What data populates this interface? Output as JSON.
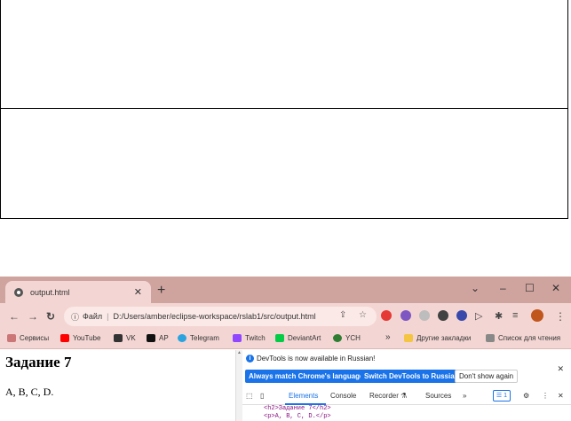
{
  "browser": {
    "tab_title": "output.html",
    "tab_close": "✕",
    "new_tab": "+",
    "window_controls": [
      "⌄",
      "–",
      "☐",
      "✕"
    ],
    "address_prefix": "Файл",
    "address_path": "D:/Users/amber/eclipse-workspace/rslab1/src/output.html",
    "bookmarks": [
      {
        "label": "Сервисы",
        "icon": "apps-icon",
        "color": "#6a6a6a"
      },
      {
        "label": "YouTube",
        "icon": "youtube-icon",
        "color": "#ff0000"
      },
      {
        "label": "VK",
        "icon": "vk-icon",
        "color": "#333333"
      },
      {
        "label": "AP",
        "icon": "ap-icon",
        "color": "#111111"
      },
      {
        "label": "Telegram",
        "icon": "telegram-icon",
        "color": "#2aa3df"
      },
      {
        "label": "Twitch",
        "icon": "twitch-icon",
        "color": "#9146ff"
      },
      {
        "label": "DeviantArt",
        "icon": "deviantart-icon",
        "color": "#05cc47"
      },
      {
        "label": "YCH",
        "icon": "ych-icon",
        "color": "#2e7d32"
      }
    ],
    "bookmarks_more": "»",
    "other_bookmarks": "Другие закладки",
    "reading_list": "Список для чтения"
  },
  "page": {
    "heading": "Задание 7",
    "paragraph": "A, B, C, D."
  },
  "devtools": {
    "notice": "DevTools is now available in Russian!",
    "btn_match": "Always match Chrome's language",
    "btn_switch": "Switch DevTools to Russian",
    "btn_dont_show": "Don't show again",
    "tabs": [
      "Elements",
      "Console",
      "Recorder ⚗",
      "Sources",
      "»"
    ],
    "issues_badge": "1",
    "code_lines": [
      "<h2>Задание 7</h2>",
      "<p>A, B, C, D.</p>"
    ]
  },
  "colors": {
    "titlebar": "#cfa39e",
    "toolbar": "#f3d6d3",
    "accent": "#1a73e8"
  }
}
